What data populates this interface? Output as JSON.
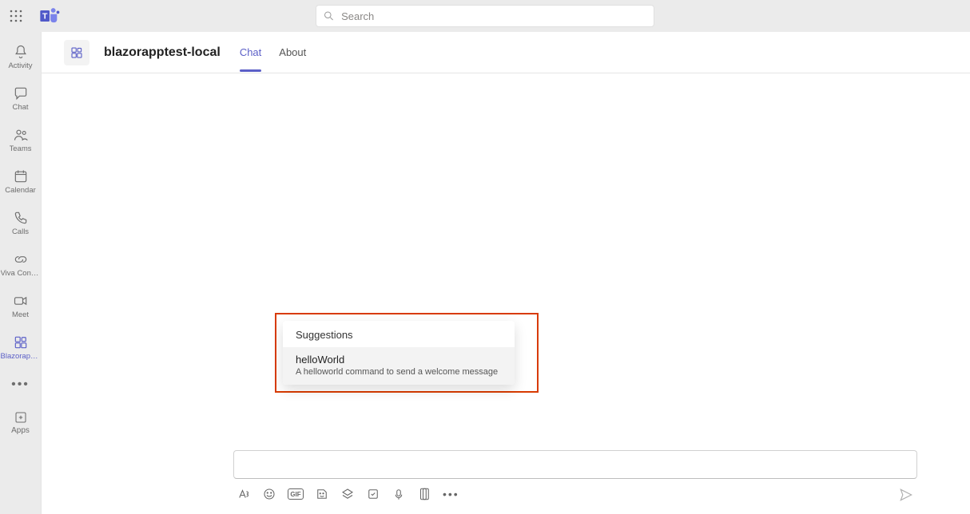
{
  "search": {
    "placeholder": "Search"
  },
  "rail": {
    "items": [
      {
        "label": "Activity"
      },
      {
        "label": "Chat"
      },
      {
        "label": "Teams"
      },
      {
        "label": "Calendar"
      },
      {
        "label": "Calls"
      },
      {
        "label": "Viva Connec..."
      },
      {
        "label": "Meet"
      },
      {
        "label": "Blazorappt..."
      }
    ],
    "apps_label": "Apps"
  },
  "header": {
    "title": "blazorapptest-local",
    "tabs": [
      {
        "label": "Chat",
        "active": true
      },
      {
        "label": "About",
        "active": false
      }
    ]
  },
  "suggestions": {
    "header": "Suggestions",
    "items": [
      {
        "title": "helloWorld",
        "desc": "A helloworld command to send a welcome message"
      }
    ]
  },
  "toolbar": {
    "gif_label": "GIF"
  }
}
